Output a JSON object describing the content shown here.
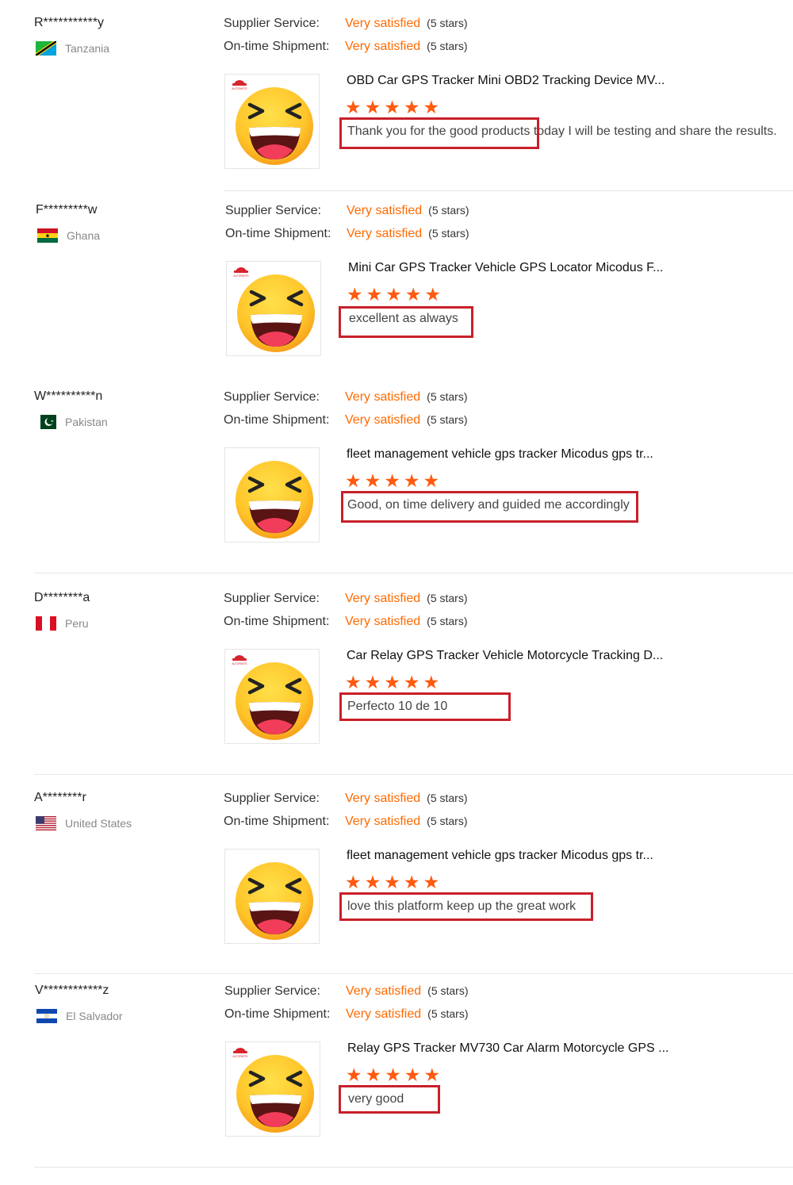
{
  "labels": {
    "supplier_service": "Supplier Service:",
    "ontime_shipment": "On-time Shipment:"
  },
  "colors": {
    "accent": "#ff6a00",
    "highlight_box": "#c8202a",
    "stars": "#ff5a10"
  },
  "reviews": [
    {
      "buyer": "R***********y",
      "country": "Tanzania",
      "flag_icon": "tanzania-flag-icon",
      "supplier_service": {
        "value": "Very satisfied",
        "stars_text": "(5 stars)"
      },
      "ontime_shipment": {
        "value": "Very satisfied",
        "stars_text": "(5 stars)"
      },
      "product_title": "OBD Car GPS Tracker Mini OBD2 Tracking Device MV...",
      "rating": 5,
      "comment": "Thank you for the good products today I will be testing and share the results.",
      "has_brand_logo": true
    },
    {
      "buyer": "F*********w",
      "country": "Ghana",
      "flag_icon": "ghana-flag-icon",
      "supplier_service": {
        "value": "Very satisfied",
        "stars_text": "(5 stars)"
      },
      "ontime_shipment": {
        "value": "Very satisfied",
        "stars_text": "(5 stars)"
      },
      "product_title": "Mini Car GPS Tracker Vehicle GPS Locator Micodus F...",
      "rating": 5,
      "comment": "excellent as always",
      "has_brand_logo": true
    },
    {
      "buyer": "W**********n",
      "country": "Pakistan",
      "flag_icon": "pakistan-flag-icon",
      "supplier_service": {
        "value": "Very satisfied",
        "stars_text": "(5 stars)"
      },
      "ontime_shipment": {
        "value": "Very satisfied",
        "stars_text": "(5 stars)"
      },
      "product_title": "fleet management vehicle gps tracker Micodus gps tr...",
      "rating": 5,
      "comment": "Good, on time delivery and guided me accordingly",
      "has_brand_logo": false
    },
    {
      "buyer": "D********a",
      "country": "Peru",
      "flag_icon": "peru-flag-icon",
      "supplier_service": {
        "value": "Very satisfied",
        "stars_text": "(5 stars)"
      },
      "ontime_shipment": {
        "value": "Very satisfied",
        "stars_text": "(5 stars)"
      },
      "product_title": "Car Relay GPS Tracker Vehicle Motorcycle Tracking D...",
      "rating": 5,
      "comment": "Perfecto 10 de 10",
      "has_brand_logo": true
    },
    {
      "buyer": "A********r",
      "country": "United States",
      "flag_icon": "united-states-flag-icon",
      "supplier_service": {
        "value": "Very satisfied",
        "stars_text": "(5 stars)"
      },
      "ontime_shipment": {
        "value": "Very satisfied",
        "stars_text": "(5 stars)"
      },
      "product_title": "fleet management vehicle gps tracker Micodus gps tr...",
      "rating": 5,
      "comment": "love this platform keep up the great work",
      "has_brand_logo": false
    },
    {
      "buyer": "V************z",
      "country": "El Salvador",
      "flag_icon": "el-salvador-flag-icon",
      "supplier_service": {
        "value": "Very satisfied",
        "stars_text": "(5 stars)"
      },
      "ontime_shipment": {
        "value": "Very satisfied",
        "stars_text": "(5 stars)"
      },
      "product_title": "Relay GPS Tracker MV730 Car Alarm Motorcycle GPS ...",
      "rating": 5,
      "comment": "very good",
      "has_brand_logo": true
    }
  ]
}
